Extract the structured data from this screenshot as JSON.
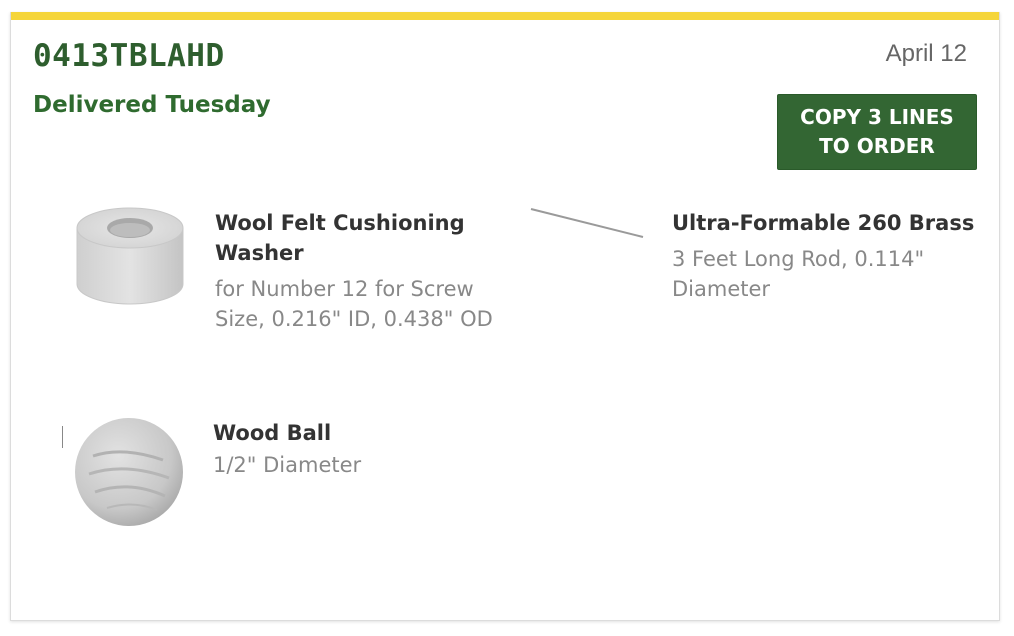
{
  "order": {
    "number": "0413TBLAHD",
    "date": "April 12",
    "status": "Delivered Tuesday",
    "copy_button": {
      "line1": "COPY 3 LINES",
      "line2": "TO ORDER"
    }
  },
  "items": [
    {
      "title": "Wool Felt Cushioning Washer",
      "description": "for Number 12 for Screw Size, 0.216\" ID, 0.438\" OD",
      "icon": "felt-washer-image"
    },
    {
      "title": "Ultra-Formable 260 Brass",
      "description": "3 Feet Long Rod, 0.114\" Diameter",
      "icon": "brass-rod-image"
    },
    {
      "title": "Wood Ball",
      "description": "1/2\" Diameter",
      "icon": "wood-ball-image"
    }
  ],
  "colors": {
    "accent": "#f5d53a",
    "brand_green": "#336633",
    "heading_green": "#2e5e2e"
  }
}
